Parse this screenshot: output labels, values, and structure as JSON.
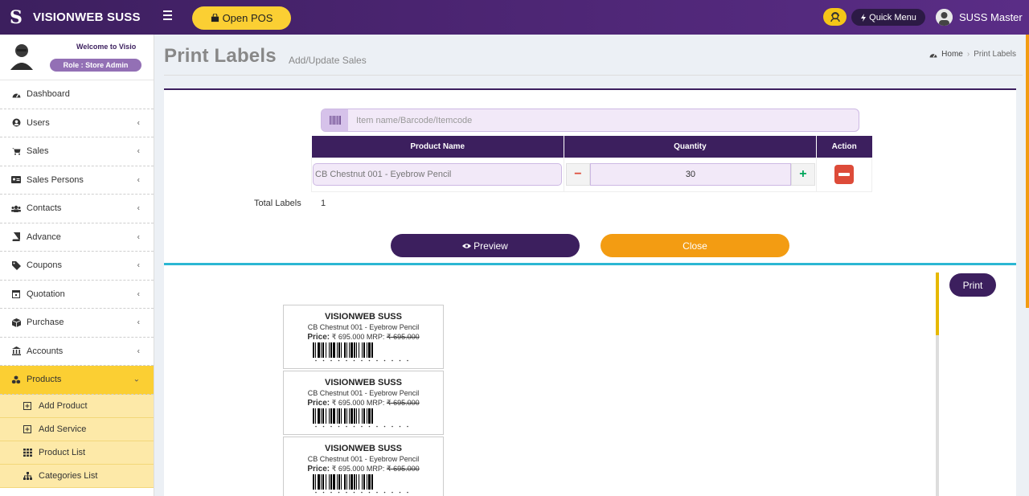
{
  "brand": {
    "name": "VISIONWEB SUSS",
    "logo_letter": "S"
  },
  "topbar": {
    "open_pos": "Open POS",
    "quick_menu": "Quick Menu",
    "user_name": "SUSS Master"
  },
  "sidebar": {
    "welcome": "Welcome to Visio",
    "role": "Role : Store Admin",
    "items": [
      {
        "label": "Dashboard",
        "icon": "dashboard-icon"
      },
      {
        "label": "Users",
        "icon": "user-icon"
      },
      {
        "label": "Sales",
        "icon": "cart-icon"
      },
      {
        "label": "Sales Persons",
        "icon": "id-card-icon"
      },
      {
        "label": "Contacts",
        "icon": "users-icon"
      },
      {
        "label": "Advance",
        "icon": "book-icon"
      },
      {
        "label": "Coupons",
        "icon": "tag-icon"
      },
      {
        "label": "Quotation",
        "icon": "calendar-icon"
      },
      {
        "label": "Purchase",
        "icon": "cube-icon"
      },
      {
        "label": "Accounts",
        "icon": "bank-icon"
      },
      {
        "label": "Products",
        "icon": "cubes-icon"
      }
    ],
    "sub_items": [
      {
        "label": "Add Product",
        "icon": "plus-square-icon"
      },
      {
        "label": "Add Service",
        "icon": "plus-square-icon"
      },
      {
        "label": "Product List",
        "icon": "grid-icon"
      },
      {
        "label": "Categories List",
        "icon": "sitemap-icon"
      }
    ]
  },
  "page": {
    "title": "Print Labels",
    "subtitle": "Add/Update Sales"
  },
  "breadcrumb": {
    "home": "Home",
    "current": "Print Labels"
  },
  "search": {
    "placeholder": "Item name/Barcode/Itemcode"
  },
  "table": {
    "headers": [
      "Product Name",
      "Quantity",
      "Action"
    ],
    "rows": [
      {
        "product_name": "CB Chestnut 001 - Eyebrow Pencil",
        "quantity": "30"
      }
    ]
  },
  "totals": {
    "label": "Total Labels",
    "value": "1"
  },
  "buttons": {
    "preview": "Preview",
    "close": "Close",
    "print": "Print"
  },
  "labels": [
    {
      "store": "VISIONWEB SUSS",
      "product": "CB Chestnut 001 - Eyebrow Pencil",
      "price_label": "Price:",
      "price": "₹ 695.000",
      "mrp_label": "MRP:",
      "mrp": "₹ 695.000"
    },
    {
      "store": "VISIONWEB SUSS",
      "product": "CB Chestnut 001 - Eyebrow Pencil",
      "price_label": "Price:",
      "price": "₹ 695.000",
      "mrp_label": "MRP:",
      "mrp": "₹ 695.000"
    },
    {
      "store": "VISIONWEB SUSS",
      "product": "CB Chestnut 001 - Eyebrow Pencil",
      "price_label": "Price:",
      "price": "₹ 695.000",
      "mrp_label": "MRP:",
      "mrp": "₹ 695.000"
    }
  ],
  "colors": {
    "primary": "#3c1f5e",
    "accent": "#fbcf33",
    "close": "#f39c12",
    "danger": "#dd4b39",
    "divider": "#2bb7d3"
  }
}
